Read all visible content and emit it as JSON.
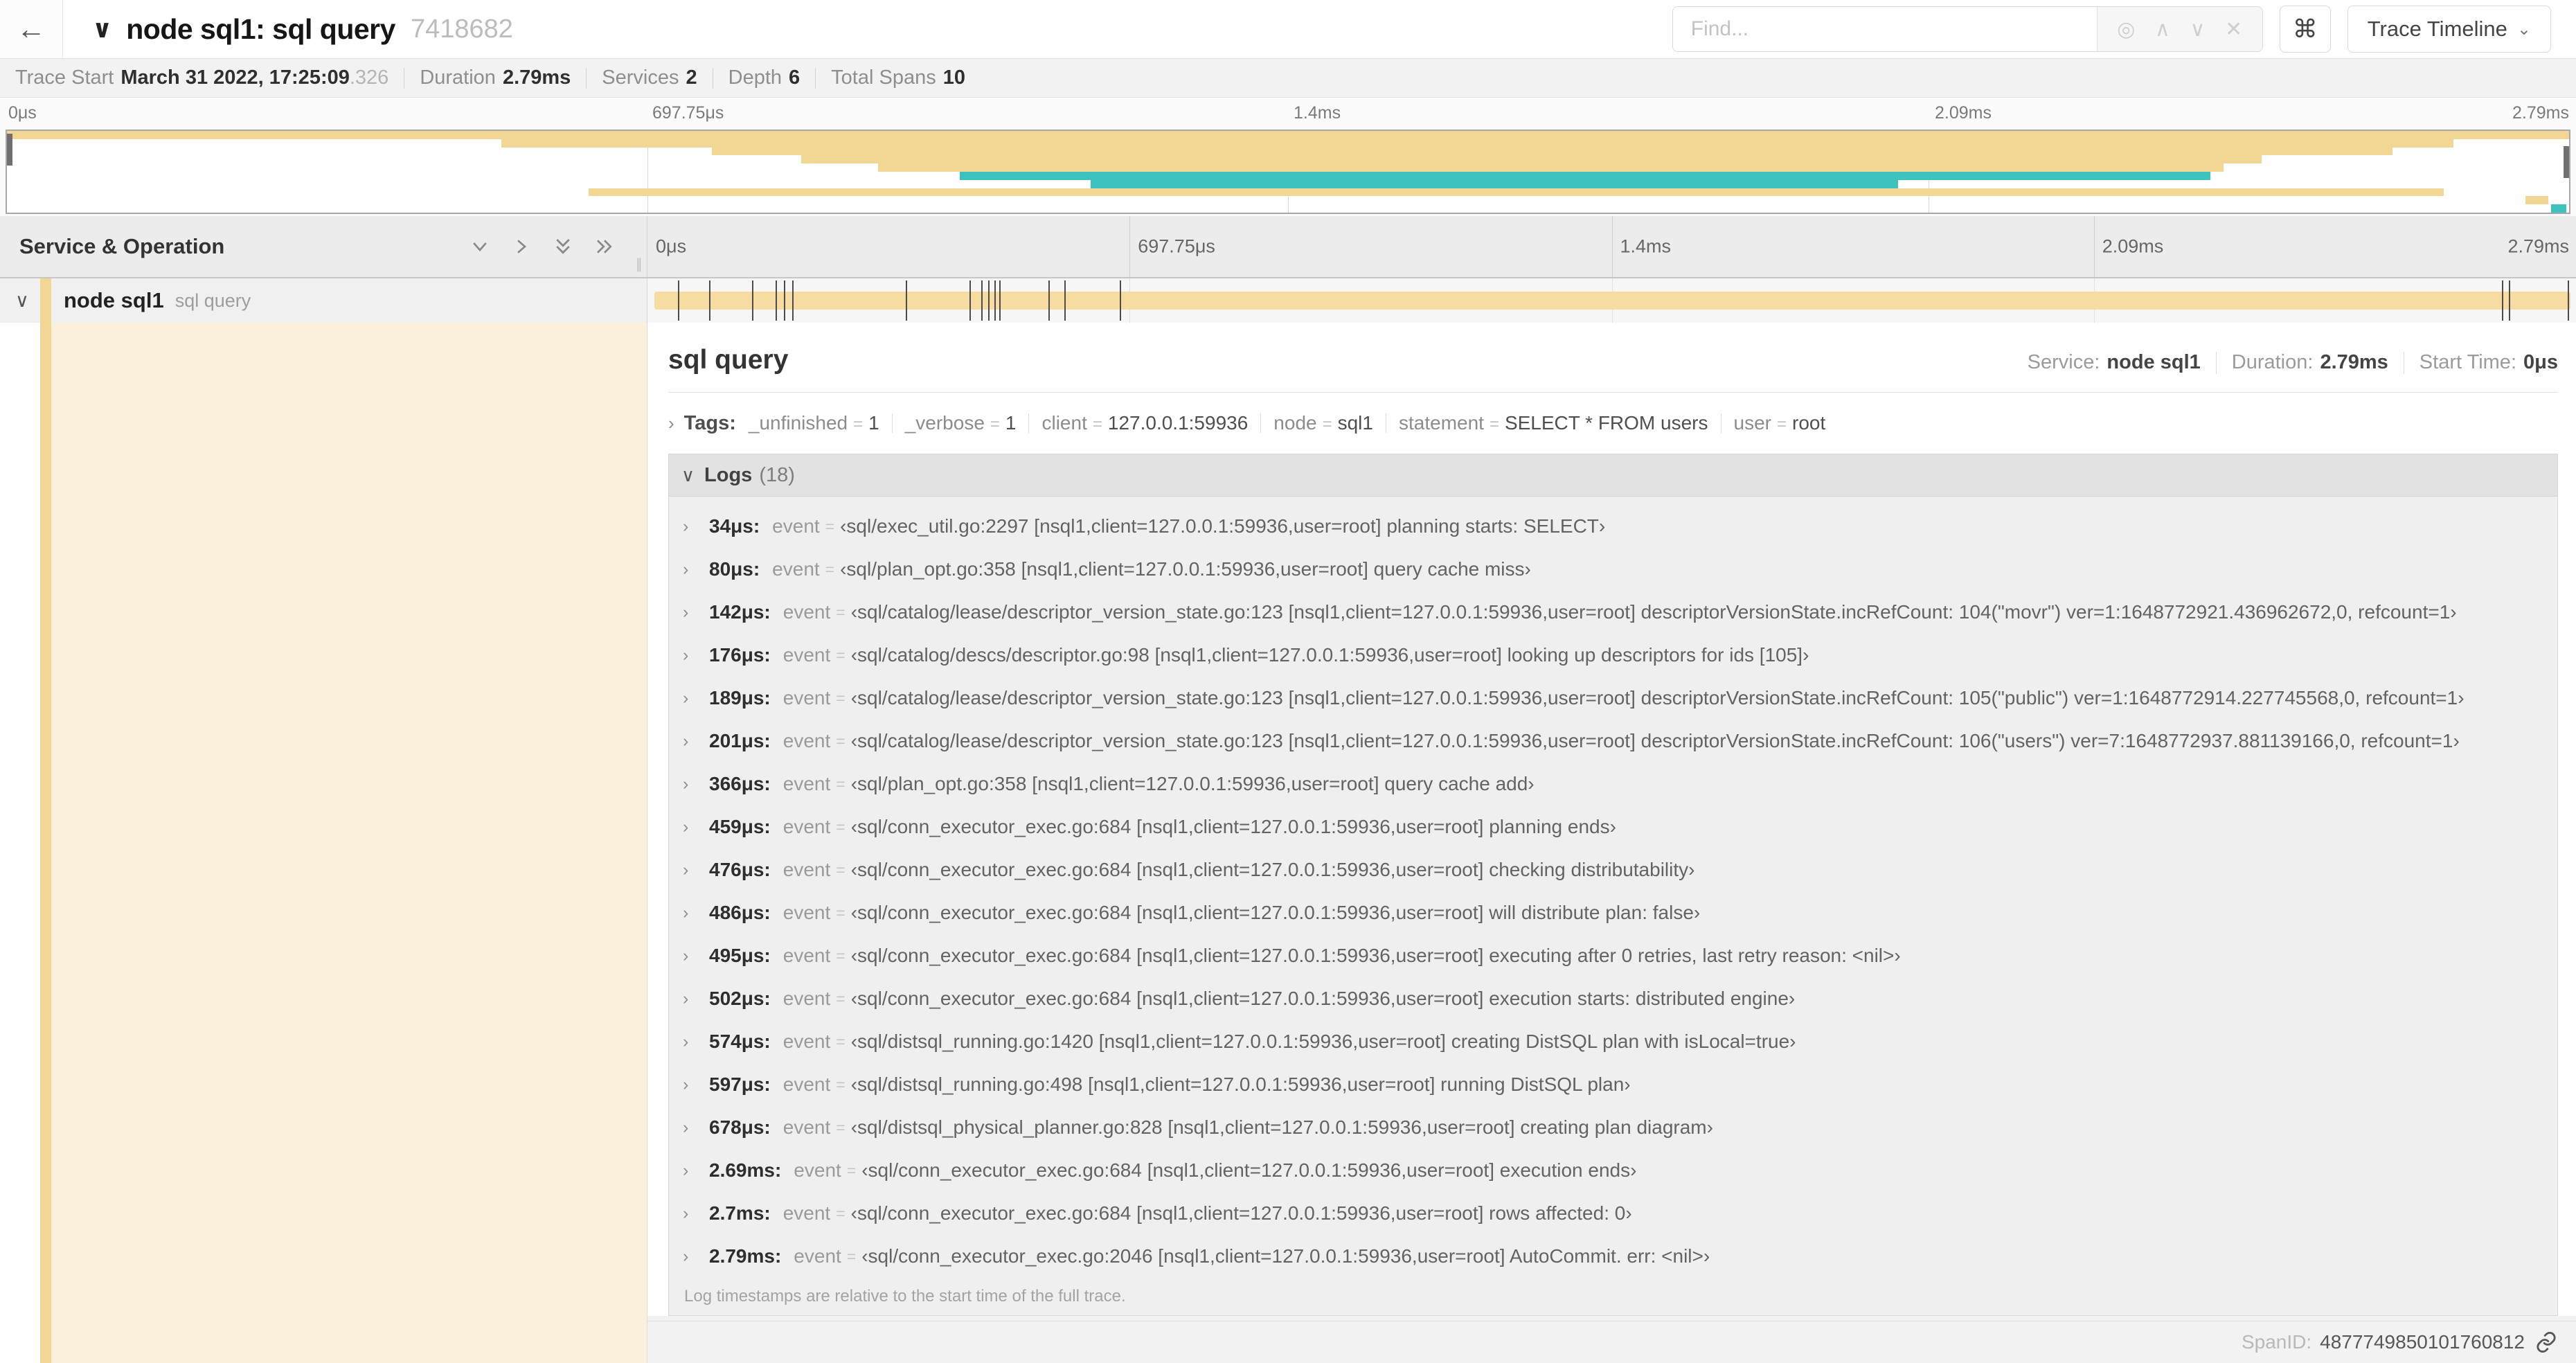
{
  "header": {
    "back_icon": "←",
    "collapse_icon": "∨",
    "title": "node sql1: sql query",
    "trace_id": "7418682",
    "find_placeholder": "Find...",
    "find_tools": {
      "target": "◎",
      "prev": "∧",
      "next": "∨",
      "clear": "✕"
    },
    "shortcuts_button": "⌘",
    "view_button_label": "Trace Timeline",
    "view_button_chevron": "⌄"
  },
  "trace_stats": {
    "items": [
      {
        "label": "Trace Start",
        "value": "March 31 2022, 17:25:09",
        "suffix": ".326"
      },
      {
        "label": "Duration",
        "value": "2.79ms"
      },
      {
        "label": "Services",
        "value": "2"
      },
      {
        "label": "Depth",
        "value": "6"
      },
      {
        "label": "Total Spans",
        "value": "10"
      }
    ]
  },
  "minimap": {
    "ticks": [
      "0μs",
      "697.75μs",
      "1.4ms",
      "2.09ms",
      "2.79ms"
    ],
    "spans": [
      {
        "start": 0,
        "end": 100,
        "color": "tan"
      },
      {
        "start": 19.3,
        "end": 95.5,
        "color": "tan"
      },
      {
        "start": 27.5,
        "end": 93.1,
        "color": "tan"
      },
      {
        "start": 31.0,
        "end": 88.0,
        "color": "tan"
      },
      {
        "start": 34.0,
        "end": 86.5,
        "color": "tan"
      },
      {
        "start": 37.2,
        "end": 86.0,
        "color": "teal"
      },
      {
        "start": 42.3,
        "end": 73.8,
        "color": "teal"
      },
      {
        "start": 22.7,
        "end": 95.1,
        "color": "tan"
      },
      {
        "start": 98.3,
        "end": 99.2,
        "color": "tan"
      },
      {
        "start": 99.3,
        "end": 99.9,
        "color": "teal"
      }
    ]
  },
  "timeline_header": {
    "left_title": "Service & Operation",
    "ticks": [
      "0μs",
      "697.75μs",
      "1.4ms",
      "2.09ms",
      "2.79ms"
    ]
  },
  "span_row": {
    "chevron": "∨",
    "service": "node sql1",
    "operation": "sql query"
  },
  "detail": {
    "title": "sql query",
    "overview": [
      {
        "label": "Service:",
        "value": "node sql1"
      },
      {
        "label": "Duration:",
        "value": "2.79ms"
      },
      {
        "label": "Start Time:",
        "value": "0μs"
      }
    ],
    "tags_label": "Tags:",
    "tags": [
      {
        "key": "_unfinished",
        "value": "1"
      },
      {
        "key": "_verbose",
        "value": "1"
      },
      {
        "key": "client",
        "value": "127.0.0.1:59936"
      },
      {
        "key": "node",
        "value": "sql1"
      },
      {
        "key": "statement",
        "value": "SELECT * FROM users"
      },
      {
        "key": "user",
        "value": "root"
      }
    ],
    "logs_title": "Logs",
    "logs_count": "(18)",
    "logs": [
      {
        "t": "34μs:",
        "field": "event",
        "value": "‹sql/exec_util.go:2297 [nsql1,client=127.0.0.1:59936,user=root] planning starts: SELECT›",
        "pct": 1.22
      },
      {
        "t": "80μs:",
        "field": "event",
        "value": "‹sql/plan_opt.go:358 [nsql1,client=127.0.0.1:59936,user=root] query cache miss›",
        "pct": 2.87
      },
      {
        "t": "142μs:",
        "field": "event",
        "value": "‹sql/catalog/lease/descriptor_version_state.go:123 [nsql1,client=127.0.0.1:59936,user=root] descriptorVersionState.incRefCount: 104(\"movr\") ver=1:1648772921.436962672,0, refcount=1›",
        "pct": 5.09
      },
      {
        "t": "176μs:",
        "field": "event",
        "value": "‹sql/catalog/descs/descriptor.go:98 [nsql1,client=127.0.0.1:59936,user=root] looking up descriptors for ids [105]›",
        "pct": 6.31
      },
      {
        "t": "189μs:",
        "field": "event",
        "value": "‹sql/catalog/lease/descriptor_version_state.go:123 [nsql1,client=127.0.0.1:59936,user=root] descriptorVersionState.incRefCount: 105(\"public\") ver=1:1648772914.227745568,0, refcount=1›",
        "pct": 6.77
      },
      {
        "t": "201μs:",
        "field": "event",
        "value": "‹sql/catalog/lease/descriptor_version_state.go:123 [nsql1,client=127.0.0.1:59936,user=root] descriptorVersionState.incRefCount: 106(\"users\") ver=7:1648772937.881139166,0, refcount=1›",
        "pct": 7.2
      },
      {
        "t": "366μs:",
        "field": "event",
        "value": "‹sql/plan_opt.go:358 [nsql1,client=127.0.0.1:59936,user=root] query cache add›",
        "pct": 13.12
      },
      {
        "t": "459μs:",
        "field": "event",
        "value": "‹sql/conn_executor_exec.go:684 [nsql1,client=127.0.0.1:59936,user=root] planning ends›",
        "pct": 16.45
      },
      {
        "t": "476μs:",
        "field": "event",
        "value": "‹sql/conn_executor_exec.go:684 [nsql1,client=127.0.0.1:59936,user=root] checking distributability›",
        "pct": 17.06
      },
      {
        "t": "486μs:",
        "field": "event",
        "value": "‹sql/conn_executor_exec.go:684 [nsql1,client=127.0.0.1:59936,user=root] will distribute plan: false›",
        "pct": 17.42
      },
      {
        "t": "495μs:",
        "field": "event",
        "value": "‹sql/conn_executor_exec.go:684 [nsql1,client=127.0.0.1:59936,user=root] executing after 0 retries, last retry reason: <nil>›",
        "pct": 17.74
      },
      {
        "t": "502μs:",
        "field": "event",
        "value": "‹sql/conn_executor_exec.go:684 [nsql1,client=127.0.0.1:59936,user=root] execution starts: distributed engine›",
        "pct": 17.99
      },
      {
        "t": "574μs:",
        "field": "event",
        "value": "‹sql/distsql_running.go:1420 [nsql1,client=127.0.0.1:59936,user=root] creating DistSQL plan with isLocal=true›",
        "pct": 20.57
      },
      {
        "t": "597μs:",
        "field": "event",
        "value": "‹sql/distsql_running.go:498 [nsql1,client=127.0.0.1:59936,user=root] running DistSQL plan›",
        "pct": 21.4
      },
      {
        "t": "678μs:",
        "field": "event",
        "value": "‹sql/distsql_physical_planner.go:828 [nsql1,client=127.0.0.1:59936,user=root] creating plan diagram›",
        "pct": 24.3
      },
      {
        "t": "2.69ms:",
        "field": "event",
        "value": "‹sql/conn_executor_exec.go:684 [nsql1,client=127.0.0.1:59936,user=root] execution ends›",
        "pct": 96.42
      },
      {
        "t": "2.7ms:",
        "field": "event",
        "value": "‹sql/conn_executor_exec.go:684 [nsql1,client=127.0.0.1:59936,user=root] rows affected: 0›",
        "pct": 96.77
      },
      {
        "t": "2.79ms:",
        "field": "event",
        "value": "‹sql/conn_executor_exec.go:2046 [nsql1,client=127.0.0.1:59936,user=root] AutoCommit. err: <nil>›",
        "pct": 99.85
      }
    ],
    "logs_footer": "Log timestamps are relative to the start time of the full trace.",
    "span_id_label": "SpanID:",
    "span_id": "4877749850101760812"
  },
  "colors": {
    "tan": "#f2d694",
    "teal": "#3dc2be",
    "cream": "#faf0dc",
    "bar_tan": "#f7dca2"
  }
}
